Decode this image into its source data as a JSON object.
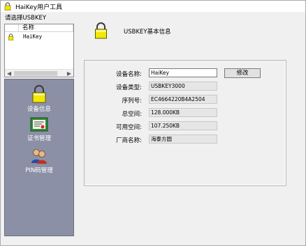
{
  "window": {
    "title": "HaiKey用户工具"
  },
  "select_label": "请选择USBKEY",
  "list": {
    "column_header": "名称",
    "rows": [
      {
        "name": "HaiKey"
      }
    ]
  },
  "nav": [
    {
      "label": "设备信息",
      "icon": "lock-icon"
    },
    {
      "label": "证书管理",
      "icon": "certificate-icon"
    },
    {
      "label": "PIN码管理",
      "icon": "users-icon"
    }
  ],
  "panel": {
    "title": "USBKEY基本信息",
    "modify_label": "修改",
    "fields": [
      {
        "label": "设备名称:",
        "value": "HaiKey"
      },
      {
        "label": "设备类型:",
        "value": "USBKEY3000"
      },
      {
        "label": "序列号:",
        "value": "EC4664220B4A2504"
      },
      {
        "label": "总空间:",
        "value": "128.000KB"
      },
      {
        "label": "可用空间:",
        "value": "107.250KB"
      },
      {
        "label": "厂商名称:",
        "value": "海泰方圆"
      }
    ]
  },
  "colors": {
    "nav_background": "#8c90a6",
    "lock_yellow": "#f2e800"
  }
}
